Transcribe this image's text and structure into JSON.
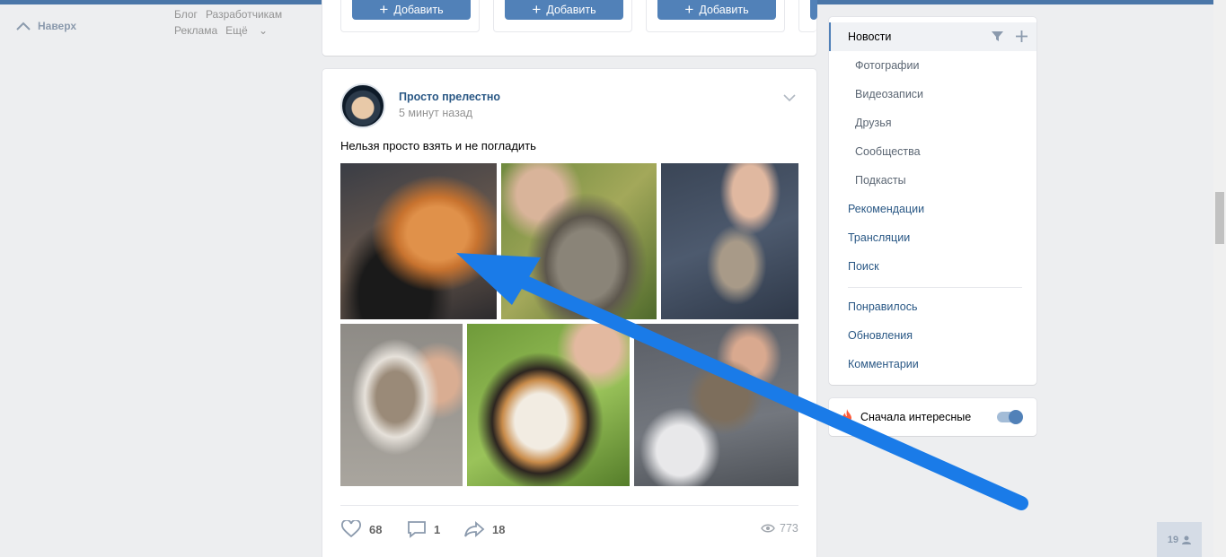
{
  "nav": {
    "up_label": "Наверх"
  },
  "footer_links": {
    "blog": "Блог",
    "developers": "Разработчикам",
    "ads": "Реклама",
    "more": "Ещё"
  },
  "suggestions": {
    "add_labels": [
      "Добавить",
      "Добавить",
      "Добавить"
    ]
  },
  "post": {
    "author": "Просто прелестно",
    "time": "5 минут назад",
    "text": "Нельзя просто взять и не погладить",
    "likes": "68",
    "comments": "1",
    "shares": "18",
    "views": "773"
  },
  "right_menu": {
    "items": [
      "Новости",
      "Фотографии",
      "Видеозаписи",
      "Друзья",
      "Сообщества",
      "Подкасты",
      "Рекомендации",
      "Трансляции",
      "Поиск",
      "Понравилось",
      "Обновления",
      "Комментарии"
    ]
  },
  "interest": {
    "label": "Сначала интересные",
    "enabled": true
  },
  "online": {
    "count": "19"
  },
  "colors": {
    "accent": "#5181b8",
    "link": "#2a5885",
    "arrow": "#1a7be8"
  }
}
